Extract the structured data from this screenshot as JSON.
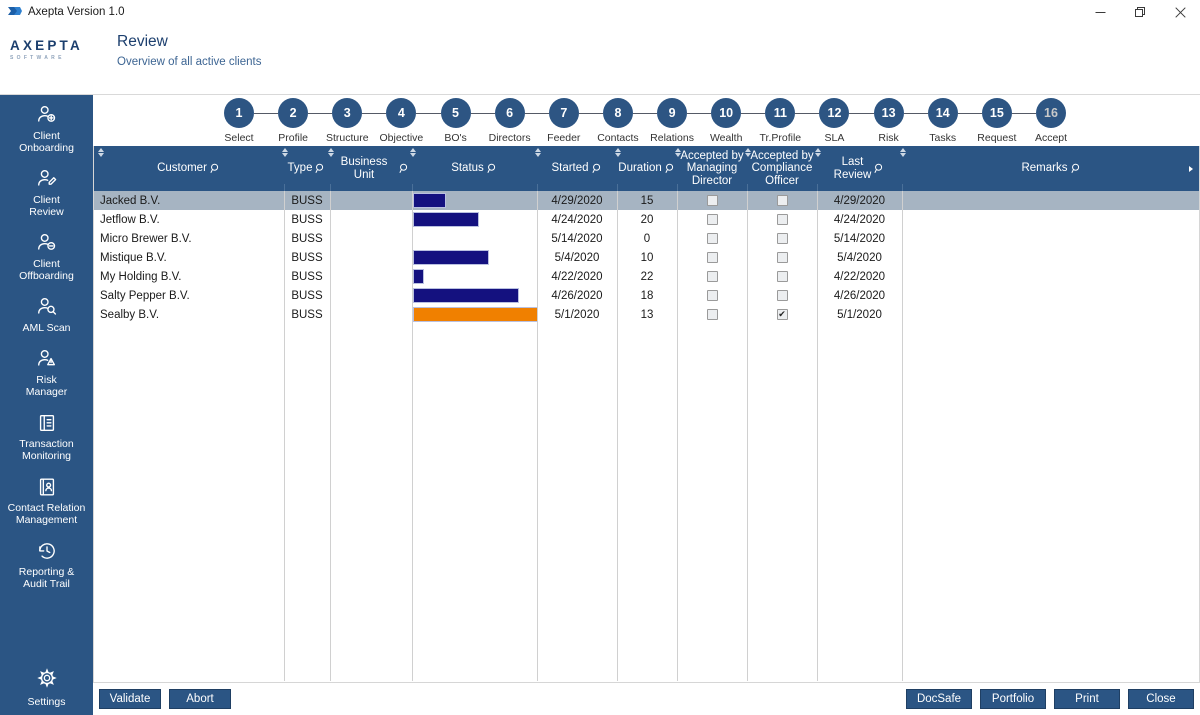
{
  "window": {
    "title": "Axepta Version 1.0",
    "controls": [
      {
        "name": "minimize",
        "glyph": "minimize-icon"
      },
      {
        "name": "maximize",
        "glyph": "restore-icon"
      },
      {
        "name": "close",
        "glyph": "close-icon"
      }
    ]
  },
  "brand": {
    "name": "AXEPTA",
    "tagline": "SOFTWARE"
  },
  "header": {
    "title": "Review",
    "subtitle": "Overview of all active clients"
  },
  "sidebar": {
    "items": [
      {
        "label": "Client\nOnboarding",
        "icon": "user-add-icon"
      },
      {
        "label": "Client\nReview",
        "icon": "user-edit-icon"
      },
      {
        "label": "Client\nOffboarding",
        "icon": "user-remove-icon"
      },
      {
        "label": "AML Scan",
        "icon": "user-search-icon"
      },
      {
        "label": "Risk\nManager",
        "icon": "user-warning-icon"
      },
      {
        "label": "Transaction\nMonitoring",
        "icon": "transaction-icon"
      },
      {
        "label": "Contact Relation\nManagement",
        "icon": "contact-book-icon"
      },
      {
        "label": "Reporting &\nAudit Trail",
        "icon": "history-clock-icon"
      }
    ],
    "settings": {
      "label": "Settings",
      "icon": "gear-icon"
    }
  },
  "stepper": {
    "steps": [
      {
        "num": "1",
        "label": "Select"
      },
      {
        "num": "2",
        "label": "Profile"
      },
      {
        "num": "3",
        "label": "Structure"
      },
      {
        "num": "4",
        "label": "Objective"
      },
      {
        "num": "5",
        "label": "BO's"
      },
      {
        "num": "6",
        "label": "Directors"
      },
      {
        "num": "7",
        "label": "Feeder"
      },
      {
        "num": "8",
        "label": "Contacts"
      },
      {
        "num": "9",
        "label": "Relations"
      },
      {
        "num": "10",
        "label": "Wealth"
      },
      {
        "num": "11",
        "label": "Tr.Profile"
      },
      {
        "num": "12",
        "label": "SLA"
      },
      {
        "num": "13",
        "label": "Risk"
      },
      {
        "num": "14",
        "label": "Tasks"
      },
      {
        "num": "15",
        "label": "Request"
      },
      {
        "num": "16",
        "label": "Accept"
      }
    ]
  },
  "table": {
    "columns": [
      {
        "key": "customer",
        "label": "Customer",
        "search": true
      },
      {
        "key": "type",
        "label": "Type",
        "search": true
      },
      {
        "key": "business_unit",
        "label": "Business Unit",
        "search": true
      },
      {
        "key": "status",
        "label": "Status",
        "search": true
      },
      {
        "key": "started",
        "label": "Started",
        "search": true
      },
      {
        "key": "duration",
        "label": "Duration",
        "search": true
      },
      {
        "key": "accepted_md",
        "label": "Accepted by\nManaging\nDirector",
        "search": false
      },
      {
        "key": "accepted_co",
        "label": "Accepted by\nCompliance\nOfficer",
        "search": false
      },
      {
        "key": "last_review",
        "label": "Last\nReview",
        "search": true
      },
      {
        "key": "remarks",
        "label": "Remarks",
        "search": true
      }
    ],
    "rows": [
      {
        "customer": "Jacked B.V.",
        "type": "BUSS",
        "business_unit": "",
        "status_pct": 26,
        "status_color": "#14117f",
        "started": "4/29/2020",
        "duration": "15",
        "accepted_md": false,
        "accepted_co": false,
        "last_review": "4/29/2020",
        "remarks": "",
        "selected": true
      },
      {
        "customer": "Jetflow B.V.",
        "type": "BUSS",
        "business_unit": "",
        "status_pct": 53,
        "status_color": "#14117f",
        "started": "4/24/2020",
        "duration": "20",
        "accepted_md": false,
        "accepted_co": false,
        "last_review": "4/24/2020",
        "remarks": "",
        "selected": false
      },
      {
        "customer": "Micro Brewer B.V.",
        "type": "BUSS",
        "business_unit": "",
        "status_pct": 0,
        "status_color": "#14117f",
        "started": "5/14/2020",
        "duration": "0",
        "accepted_md": false,
        "accepted_co": false,
        "last_review": "5/14/2020",
        "remarks": "",
        "selected": false
      },
      {
        "customer": "Mistique B.V.",
        "type": "BUSS",
        "business_unit": "",
        "status_pct": 61,
        "status_color": "#14117f",
        "started": "5/4/2020",
        "duration": "10",
        "accepted_md": false,
        "accepted_co": false,
        "last_review": "5/4/2020",
        "remarks": "",
        "selected": false
      },
      {
        "customer": "My Holding B.V.",
        "type": "BUSS",
        "business_unit": "",
        "status_pct": 9,
        "status_color": "#14117f",
        "started": "4/22/2020",
        "duration": "22",
        "accepted_md": false,
        "accepted_co": false,
        "last_review": "4/22/2020",
        "remarks": "",
        "selected": false
      },
      {
        "customer": "Salty Pepper B.V.",
        "type": "BUSS",
        "business_unit": "",
        "status_pct": 85,
        "status_color": "#14117f",
        "started": "4/26/2020",
        "duration": "18",
        "accepted_md": false,
        "accepted_co": false,
        "last_review": "4/26/2020",
        "remarks": "",
        "selected": false
      },
      {
        "customer": "Sealby B.V.",
        "type": "BUSS",
        "business_unit": "",
        "status_pct": 100,
        "status_color": "#f08000",
        "started": "5/1/2020",
        "duration": "13",
        "accepted_md": false,
        "accepted_co": true,
        "last_review": "5/1/2020",
        "remarks": "",
        "selected": false
      }
    ],
    "checkbox_checked_glyph": "✔"
  },
  "footer": {
    "left_buttons": [
      {
        "label": "Validate",
        "name": "validate-button"
      },
      {
        "label": "Abort",
        "name": "abort-button"
      }
    ],
    "right_buttons": [
      {
        "label": "DocSafe",
        "name": "docsafe-button"
      },
      {
        "label": "Portfolio",
        "name": "portfolio-button"
      },
      {
        "label": "Print",
        "name": "print-button"
      },
      {
        "label": "Close",
        "name": "close-button"
      }
    ]
  },
  "colors": {
    "brand_blue": "#2b5584",
    "accent_orange": "#f08000",
    "bar_blue": "#14117f",
    "selected_row": "#a6b4c2"
  }
}
